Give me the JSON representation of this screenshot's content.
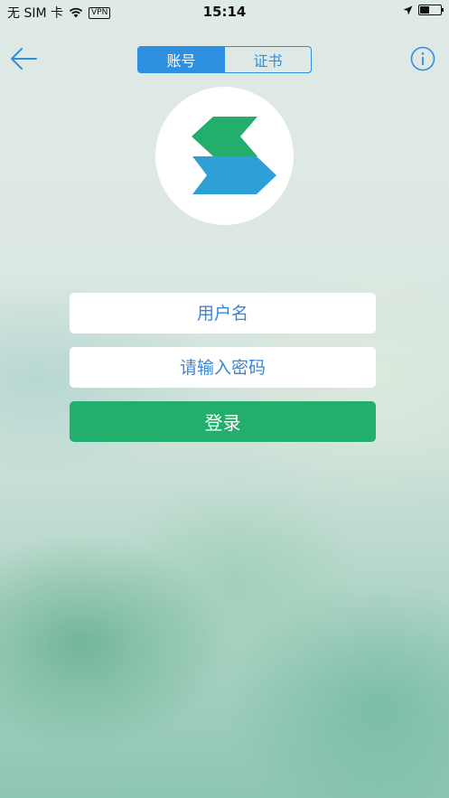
{
  "status_bar": {
    "carrier": "无 SIM 卡",
    "vpn": "VPN",
    "time": "15:14",
    "battery_level": 0.45
  },
  "nav": {
    "tabs": [
      {
        "label": "账号",
        "active": true
      },
      {
        "label": "证书",
        "active": false
      }
    ],
    "accent_color": "#2d8fe0"
  },
  "form": {
    "username_placeholder": "用户名",
    "password_placeholder": "请输入密码",
    "login_label": "登录",
    "login_color": "#24ae6d"
  },
  "logo": {
    "top_color": "#24ae6d",
    "bottom_color": "#2f9fd8"
  }
}
